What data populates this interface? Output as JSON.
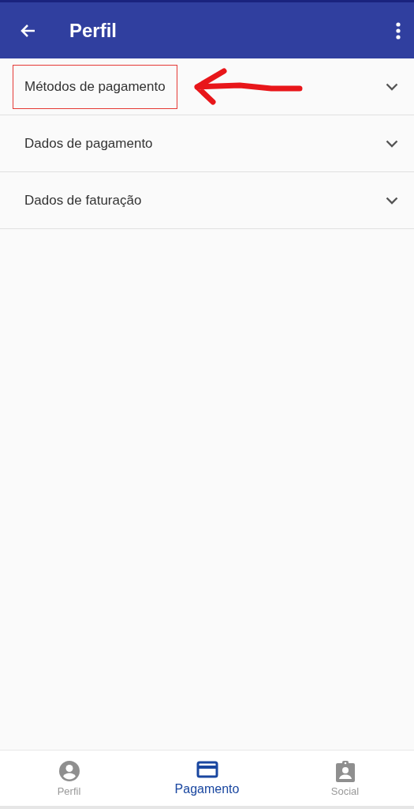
{
  "app_bar": {
    "title": "Perfil"
  },
  "sections": [
    {
      "title": "Métodos de pagamento",
      "expanded": false,
      "highlighted": true
    },
    {
      "title": "Dados de pagamento",
      "expanded": false,
      "highlighted": false
    },
    {
      "title": "Dados de faturação",
      "expanded": false,
      "highlighted": false
    }
  ],
  "bottom_nav": [
    {
      "label": "Perfil",
      "selected": false
    },
    {
      "label": "Pagamento",
      "selected": true
    },
    {
      "label": "Social",
      "selected": false
    }
  ]
}
